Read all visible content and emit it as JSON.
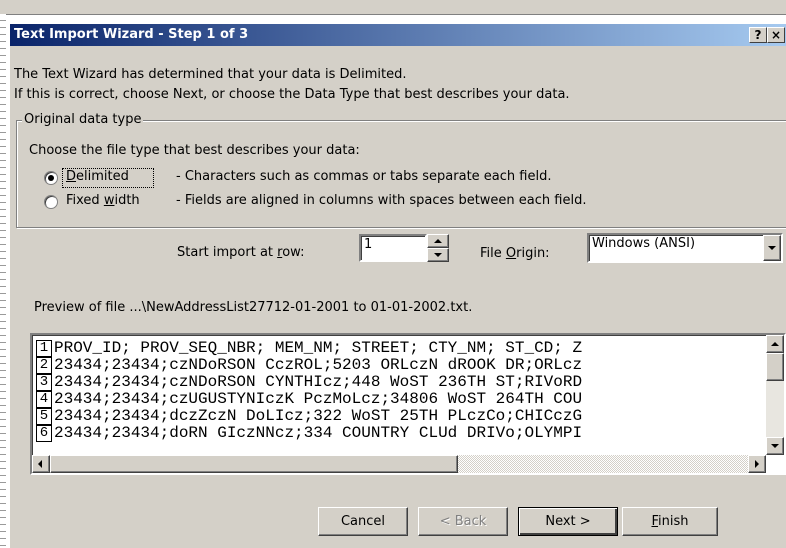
{
  "dialog": {
    "title": "Text Import Wizard - Step 1 of 3",
    "help_label": "?",
    "close_label": "×",
    "intro_line1": "The Text Wizard has determined that your data is Delimited.",
    "intro_line2": "If this is correct, choose Next, or choose the Data Type that best describes your data."
  },
  "original_data_type": {
    "group_label": "Original data type",
    "prompt": "Choose the file type that best describes your data:",
    "options": [
      {
        "label": "Delimited",
        "accel_index": 0,
        "description": "- Characters such as commas or tabs separate each field.",
        "selected": true
      },
      {
        "label": "Fixed width",
        "accel_index": 6,
        "description": "- Fields are aligned in columns with spaces between each field.",
        "selected": false
      }
    ]
  },
  "start_import": {
    "label_prefix": "Start import at ",
    "label_accel": "r",
    "label_suffix": "ow:",
    "value": "1"
  },
  "file_origin": {
    "label_prefix": "File ",
    "label_accel": "O",
    "label_suffix": "rigin:",
    "value": "Windows (ANSI)"
  },
  "preview": {
    "label": "Preview of file ...\\NewAddressList27712-01-2001 to 01-01-2002.txt.",
    "rows": [
      {
        "num": "1",
        "text": "PROV_ID; PROV_SEQ_NBR; MEM_NM; STREET; CTY_NM; ST_CD; Z"
      },
      {
        "num": "2",
        "text": "23434;23434;czNDoRSON CczROL;5203 ORLczN dROOK DR;ORLcz"
      },
      {
        "num": "3",
        "text": "23434;23434;czNDoRSON CYNTHIcz;448 WoST 236TH ST;RIVoRD"
      },
      {
        "num": "4",
        "text": "23434;23434;czUGUSTYNIczK PczMoLcz;34806 WoST 264TH COU"
      },
      {
        "num": "5",
        "text": "23434;23434;dczZczN DoLIcz;322 WoST 25TH PLczCo;CHICczG"
      },
      {
        "num": "6",
        "text": "23434;23434;doRN GIczNNcz;334 COUNTRY CLUd DRIVo;OLYMPI"
      }
    ]
  },
  "buttons": {
    "cancel": "Cancel",
    "back": "< Back",
    "next": "Next >",
    "finish_accel": "F",
    "finish_rest": "inish"
  },
  "colors": {
    "title_start": "#0a246a",
    "title_end": "#a6caf0",
    "dialog_face": "#d4d0c8"
  }
}
